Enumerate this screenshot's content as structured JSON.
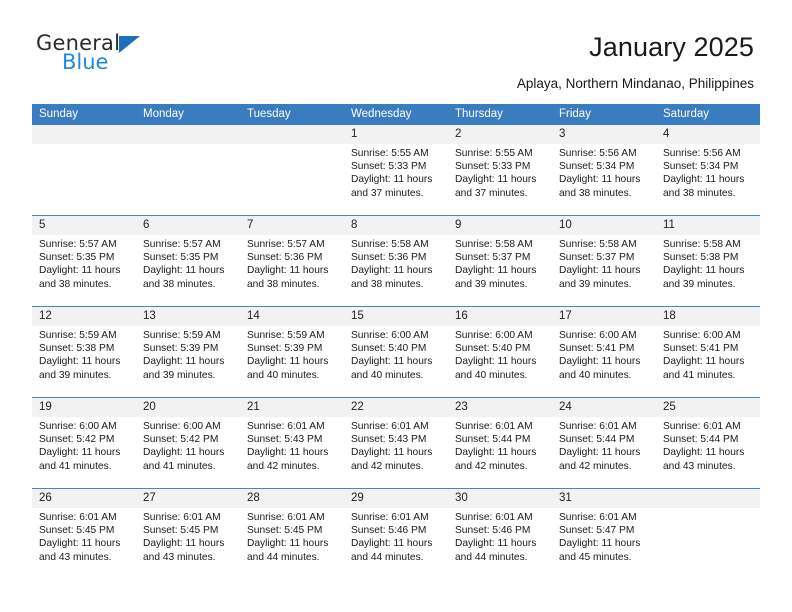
{
  "brand": {
    "name_top": "General",
    "name_bottom": "Blue",
    "triangle_color": "#1f6fc0",
    "blue_color": "#1f8ae0"
  },
  "header": {
    "title": "January 2025",
    "subtitle": "Aplaya, Northern Mindanao, Philippines",
    "header_bg": "#3a7cc0",
    "header_text": "#ffffff",
    "row_rule_color": "#4a86c6",
    "daynum_bg": "#f2f2f2"
  },
  "weekday_headers": [
    "Sunday",
    "Monday",
    "Tuesday",
    "Wednesday",
    "Thursday",
    "Friday",
    "Saturday"
  ],
  "labels": {
    "sunrise_prefix": "Sunrise: ",
    "sunset_prefix": "Sunset: ",
    "daylight_prefix": "Daylight: "
  },
  "weeks": [
    [
      {
        "day": "",
        "empty": true
      },
      {
        "day": "",
        "empty": true
      },
      {
        "day": "",
        "empty": true
      },
      {
        "day": "1",
        "sunrise": "Sunrise: 5:55 AM",
        "sunset": "Sunset: 5:33 PM",
        "daylight_line1": "Daylight: 11 hours",
        "daylight_line2": "and 37 minutes."
      },
      {
        "day": "2",
        "sunrise": "Sunrise: 5:55 AM",
        "sunset": "Sunset: 5:33 PM",
        "daylight_line1": "Daylight: 11 hours",
        "daylight_line2": "and 37 minutes."
      },
      {
        "day": "3",
        "sunrise": "Sunrise: 5:56 AM",
        "sunset": "Sunset: 5:34 PM",
        "daylight_line1": "Daylight: 11 hours",
        "daylight_line2": "and 38 minutes."
      },
      {
        "day": "4",
        "sunrise": "Sunrise: 5:56 AM",
        "sunset": "Sunset: 5:34 PM",
        "daylight_line1": "Daylight: 11 hours",
        "daylight_line2": "and 38 minutes."
      }
    ],
    [
      {
        "day": "5",
        "sunrise": "Sunrise: 5:57 AM",
        "sunset": "Sunset: 5:35 PM",
        "daylight_line1": "Daylight: 11 hours",
        "daylight_line2": "and 38 minutes."
      },
      {
        "day": "6",
        "sunrise": "Sunrise: 5:57 AM",
        "sunset": "Sunset: 5:35 PM",
        "daylight_line1": "Daylight: 11 hours",
        "daylight_line2": "and 38 minutes."
      },
      {
        "day": "7",
        "sunrise": "Sunrise: 5:57 AM",
        "sunset": "Sunset: 5:36 PM",
        "daylight_line1": "Daylight: 11 hours",
        "daylight_line2": "and 38 minutes."
      },
      {
        "day": "8",
        "sunrise": "Sunrise: 5:58 AM",
        "sunset": "Sunset: 5:36 PM",
        "daylight_line1": "Daylight: 11 hours",
        "daylight_line2": "and 38 minutes."
      },
      {
        "day": "9",
        "sunrise": "Sunrise: 5:58 AM",
        "sunset": "Sunset: 5:37 PM",
        "daylight_line1": "Daylight: 11 hours",
        "daylight_line2": "and 39 minutes."
      },
      {
        "day": "10",
        "sunrise": "Sunrise: 5:58 AM",
        "sunset": "Sunset: 5:37 PM",
        "daylight_line1": "Daylight: 11 hours",
        "daylight_line2": "and 39 minutes."
      },
      {
        "day": "11",
        "sunrise": "Sunrise: 5:58 AM",
        "sunset": "Sunset: 5:38 PM",
        "daylight_line1": "Daylight: 11 hours",
        "daylight_line2": "and 39 minutes."
      }
    ],
    [
      {
        "day": "12",
        "sunrise": "Sunrise: 5:59 AM",
        "sunset": "Sunset: 5:38 PM",
        "daylight_line1": "Daylight: 11 hours",
        "daylight_line2": "and 39 minutes."
      },
      {
        "day": "13",
        "sunrise": "Sunrise: 5:59 AM",
        "sunset": "Sunset: 5:39 PM",
        "daylight_line1": "Daylight: 11 hours",
        "daylight_line2": "and 39 minutes."
      },
      {
        "day": "14",
        "sunrise": "Sunrise: 5:59 AM",
        "sunset": "Sunset: 5:39 PM",
        "daylight_line1": "Daylight: 11 hours",
        "daylight_line2": "and 40 minutes."
      },
      {
        "day": "15",
        "sunrise": "Sunrise: 6:00 AM",
        "sunset": "Sunset: 5:40 PM",
        "daylight_line1": "Daylight: 11 hours",
        "daylight_line2": "and 40 minutes."
      },
      {
        "day": "16",
        "sunrise": "Sunrise: 6:00 AM",
        "sunset": "Sunset: 5:40 PM",
        "daylight_line1": "Daylight: 11 hours",
        "daylight_line2": "and 40 minutes."
      },
      {
        "day": "17",
        "sunrise": "Sunrise: 6:00 AM",
        "sunset": "Sunset: 5:41 PM",
        "daylight_line1": "Daylight: 11 hours",
        "daylight_line2": "and 40 minutes."
      },
      {
        "day": "18",
        "sunrise": "Sunrise: 6:00 AM",
        "sunset": "Sunset: 5:41 PM",
        "daylight_line1": "Daylight: 11 hours",
        "daylight_line2": "and 41 minutes."
      }
    ],
    [
      {
        "day": "19",
        "sunrise": "Sunrise: 6:00 AM",
        "sunset": "Sunset: 5:42 PM",
        "daylight_line1": "Daylight: 11 hours",
        "daylight_line2": "and 41 minutes."
      },
      {
        "day": "20",
        "sunrise": "Sunrise: 6:00 AM",
        "sunset": "Sunset: 5:42 PM",
        "daylight_line1": "Daylight: 11 hours",
        "daylight_line2": "and 41 minutes."
      },
      {
        "day": "21",
        "sunrise": "Sunrise: 6:01 AM",
        "sunset": "Sunset: 5:43 PM",
        "daylight_line1": "Daylight: 11 hours",
        "daylight_line2": "and 42 minutes."
      },
      {
        "day": "22",
        "sunrise": "Sunrise: 6:01 AM",
        "sunset": "Sunset: 5:43 PM",
        "daylight_line1": "Daylight: 11 hours",
        "daylight_line2": "and 42 minutes."
      },
      {
        "day": "23",
        "sunrise": "Sunrise: 6:01 AM",
        "sunset": "Sunset: 5:44 PM",
        "daylight_line1": "Daylight: 11 hours",
        "daylight_line2": "and 42 minutes."
      },
      {
        "day": "24",
        "sunrise": "Sunrise: 6:01 AM",
        "sunset": "Sunset: 5:44 PM",
        "daylight_line1": "Daylight: 11 hours",
        "daylight_line2": "and 42 minutes."
      },
      {
        "day": "25",
        "sunrise": "Sunrise: 6:01 AM",
        "sunset": "Sunset: 5:44 PM",
        "daylight_line1": "Daylight: 11 hours",
        "daylight_line2": "and 43 minutes."
      }
    ],
    [
      {
        "day": "26",
        "sunrise": "Sunrise: 6:01 AM",
        "sunset": "Sunset: 5:45 PM",
        "daylight_line1": "Daylight: 11 hours",
        "daylight_line2": "and 43 minutes."
      },
      {
        "day": "27",
        "sunrise": "Sunrise: 6:01 AM",
        "sunset": "Sunset: 5:45 PM",
        "daylight_line1": "Daylight: 11 hours",
        "daylight_line2": "and 43 minutes."
      },
      {
        "day": "28",
        "sunrise": "Sunrise: 6:01 AM",
        "sunset": "Sunset: 5:45 PM",
        "daylight_line1": "Daylight: 11 hours",
        "daylight_line2": "and 44 minutes."
      },
      {
        "day": "29",
        "sunrise": "Sunrise: 6:01 AM",
        "sunset": "Sunset: 5:46 PM",
        "daylight_line1": "Daylight: 11 hours",
        "daylight_line2": "and 44 minutes."
      },
      {
        "day": "30",
        "sunrise": "Sunrise: 6:01 AM",
        "sunset": "Sunset: 5:46 PM",
        "daylight_line1": "Daylight: 11 hours",
        "daylight_line2": "and 44 minutes."
      },
      {
        "day": "31",
        "sunrise": "Sunrise: 6:01 AM",
        "sunset": "Sunset: 5:47 PM",
        "daylight_line1": "Daylight: 11 hours",
        "daylight_line2": "and 45 minutes."
      },
      {
        "day": "",
        "empty": true
      }
    ]
  ]
}
